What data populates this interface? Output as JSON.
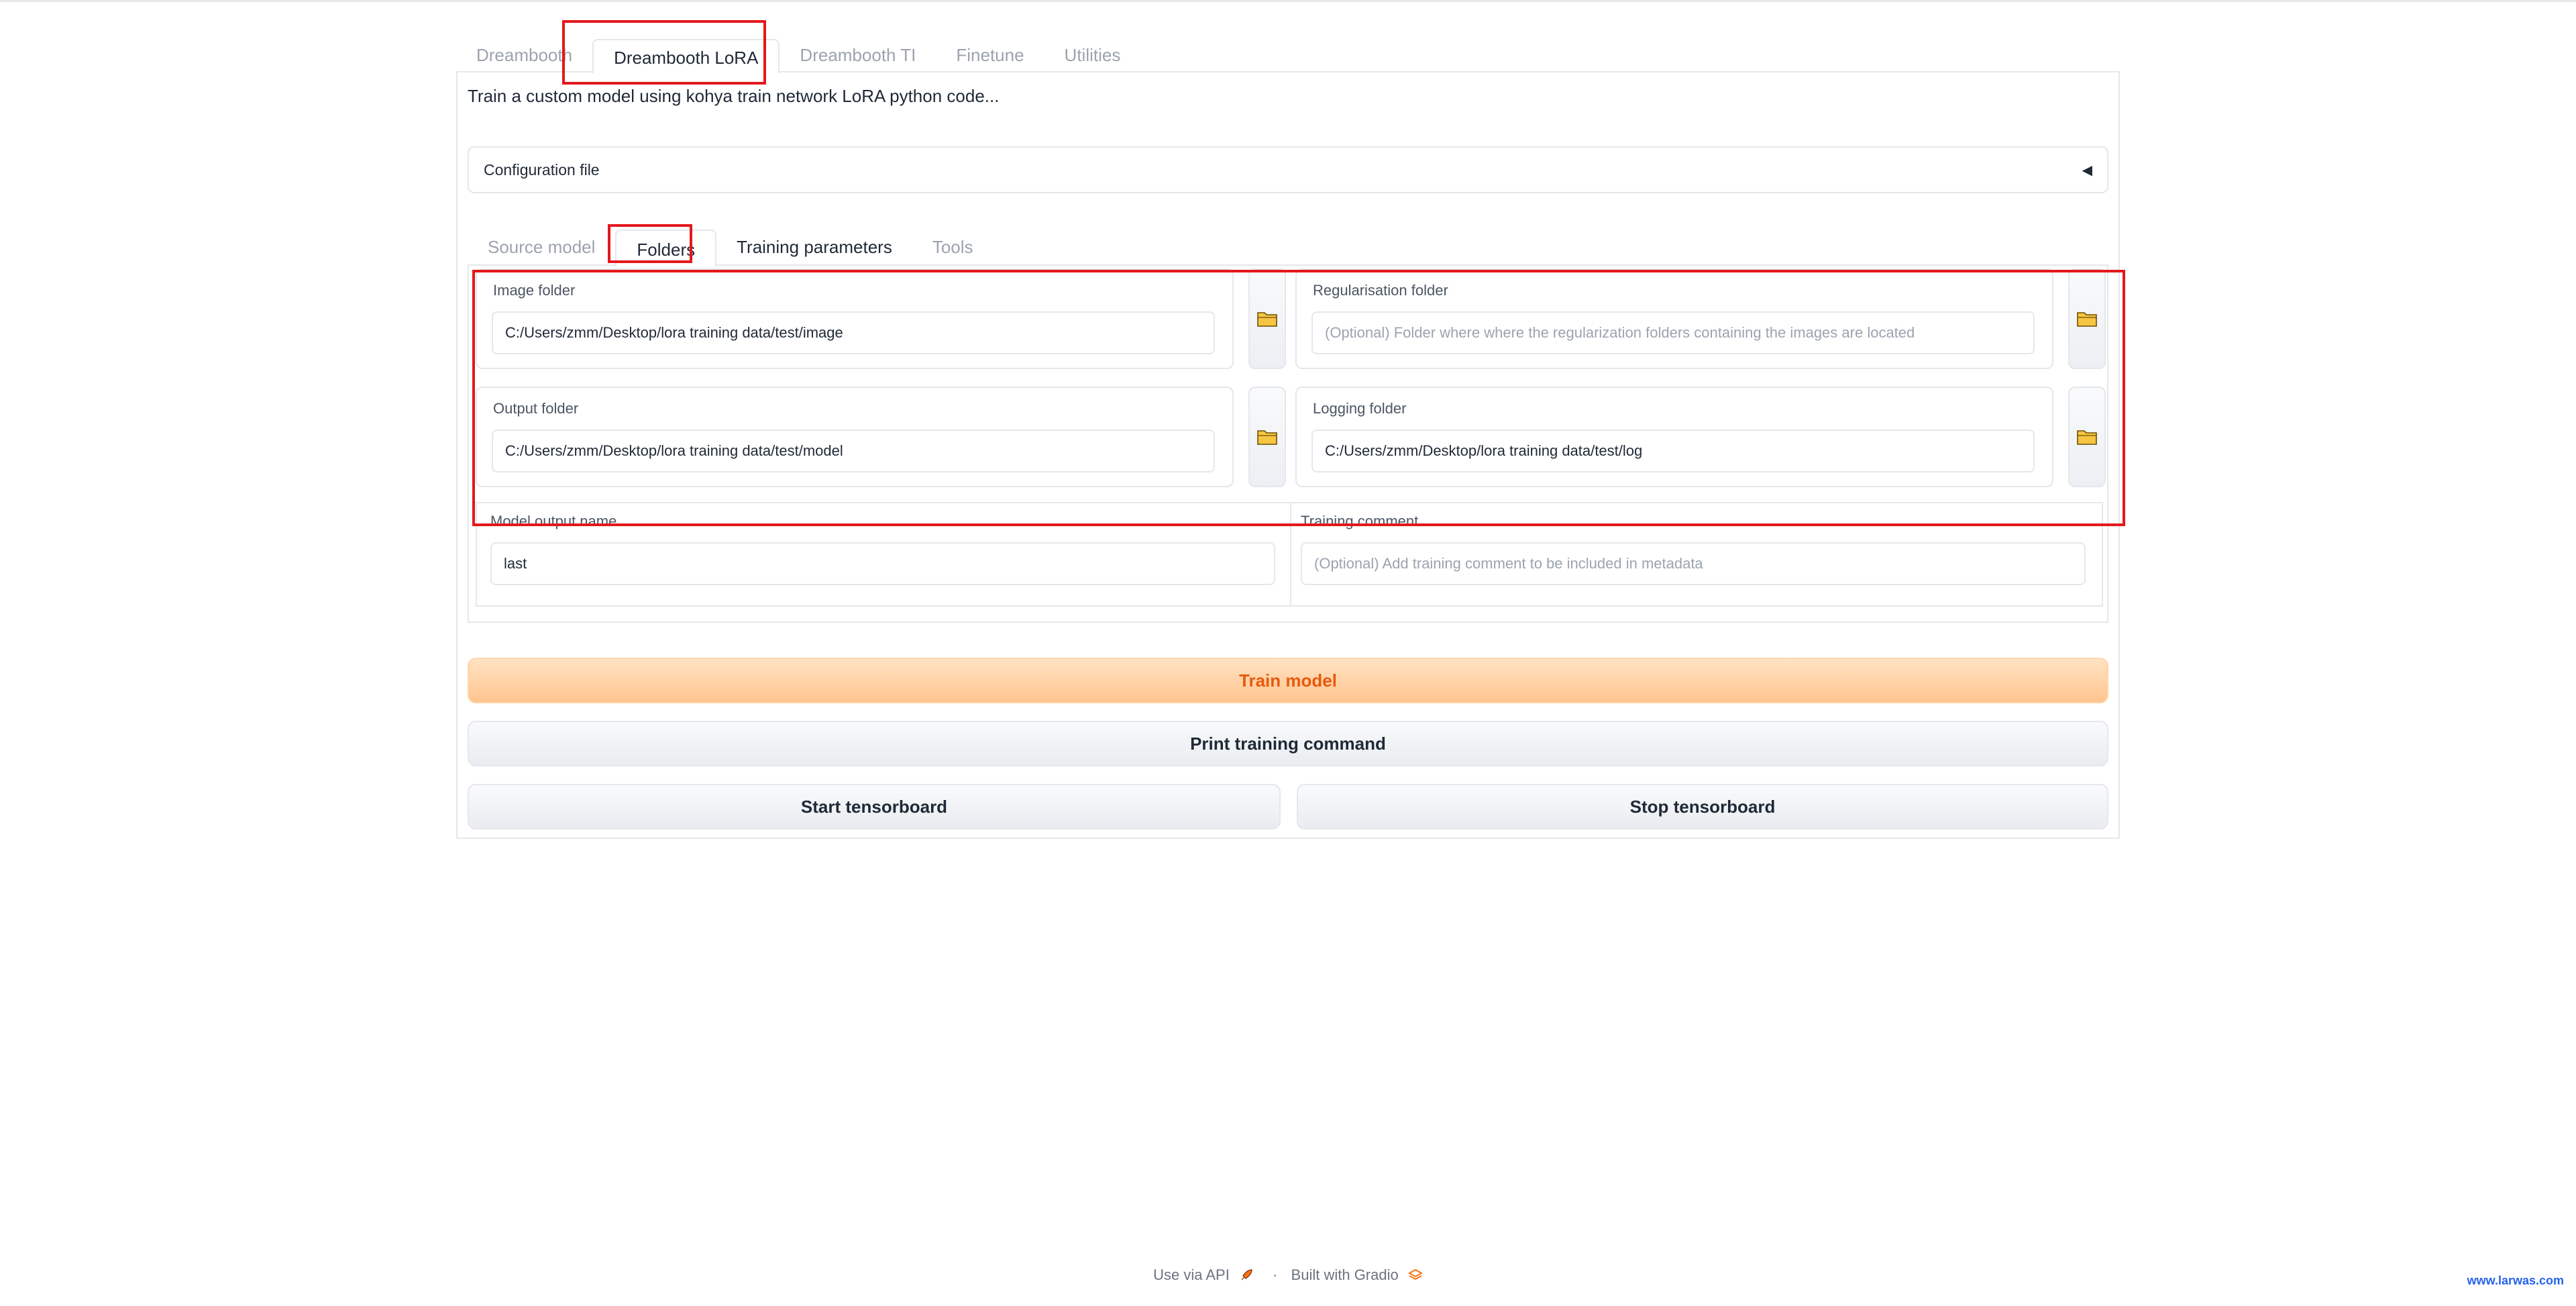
{
  "top_tabs": [
    {
      "label": "Dreambooth"
    },
    {
      "label": "Dreambooth LoRA"
    },
    {
      "label": "Dreambooth TI"
    },
    {
      "label": "Finetune"
    },
    {
      "label": "Utilities"
    }
  ],
  "description": "Train a custom model using kohya train network LoRA python code...",
  "config_accordion": {
    "label": "Configuration file",
    "arrow": "◀"
  },
  "sub_tabs": [
    {
      "label": "Source model"
    },
    {
      "label": "Folders"
    },
    {
      "label": "Training parameters"
    },
    {
      "label": "Tools"
    }
  ],
  "folders": {
    "image": {
      "label": "Image folder",
      "value": "C:/Users/zmm/Desktop/lora training data/test/image",
      "placeholder": ""
    },
    "reg": {
      "label": "Regularisation folder",
      "value": "",
      "placeholder": "(Optional) Folder where where the regularization folders containing the images are located"
    },
    "output": {
      "label": "Output folder",
      "value": "C:/Users/zmm/Desktop/lora training data/test/model",
      "placeholder": ""
    },
    "logging": {
      "label": "Logging folder",
      "value": "C:/Users/zmm/Desktop/lora training data/test/log",
      "placeholder": ""
    }
  },
  "model_output": {
    "label": "Model output name",
    "value": "last"
  },
  "training_comment": {
    "label": "Training comment",
    "value": "",
    "placeholder": "(Optional) Add training comment to be included in metadata"
  },
  "buttons": {
    "train": "Train model",
    "print": "Print training command",
    "start_tb": "Start tensorboard",
    "stop_tb": "Stop tensorboard"
  },
  "footer": {
    "api": "Use via API",
    "separator": "·",
    "built": "Built with Gradio"
  },
  "watermark": "www.larwas.com",
  "colors": {
    "primary_text": "#ea580c",
    "highlight": "#e3181c",
    "folder_icon": "#f6c543"
  }
}
